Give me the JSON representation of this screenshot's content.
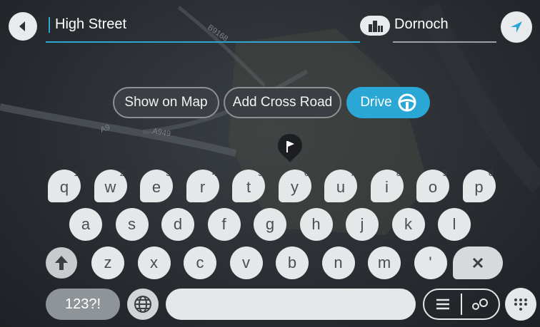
{
  "search": {
    "value": "High Street"
  },
  "place": {
    "value": "Dornoch"
  },
  "actions": {
    "show_on_map": "Show on Map",
    "add_cross_road": "Add Cross Road",
    "drive": "Drive"
  },
  "map_labels": {
    "road_a9": "A9",
    "road_a949": "A949",
    "road_b9168": "B9168"
  },
  "keyboard": {
    "row1": [
      {
        "key": "q",
        "sup": "1"
      },
      {
        "key": "w",
        "sup": "2"
      },
      {
        "key": "e",
        "sup": "3"
      },
      {
        "key": "r",
        "sup": "4"
      },
      {
        "key": "t",
        "sup": "5"
      },
      {
        "key": "y",
        "sup": "6"
      },
      {
        "key": "u",
        "sup": "7"
      },
      {
        "key": "i",
        "sup": "8"
      },
      {
        "key": "o",
        "sup": "9"
      },
      {
        "key": "p",
        "sup": "0"
      }
    ],
    "row2": [
      "a",
      "s",
      "d",
      "f",
      "g",
      "h",
      "j",
      "k",
      "l"
    ],
    "row3": [
      "z",
      "x",
      "c",
      "v",
      "b",
      "n",
      "m",
      "'"
    ],
    "symbols_label": "123?!"
  },
  "colors": {
    "accent": "#2aa7d4",
    "key": "#e6e7e9",
    "background": "#2a2e33"
  },
  "icons": {
    "back": "back-arrow-icon",
    "locate": "navigate-arrow-icon",
    "place": "city-icon",
    "drive": "steering-wheel-icon",
    "flag": "flag-icon",
    "shift": "shift-arrow-icon",
    "delete": "backspace-icon",
    "globe": "globe-icon",
    "list": "list-icon",
    "map": "map-pins-icon",
    "hide_keyboard": "keyboard-icon"
  }
}
